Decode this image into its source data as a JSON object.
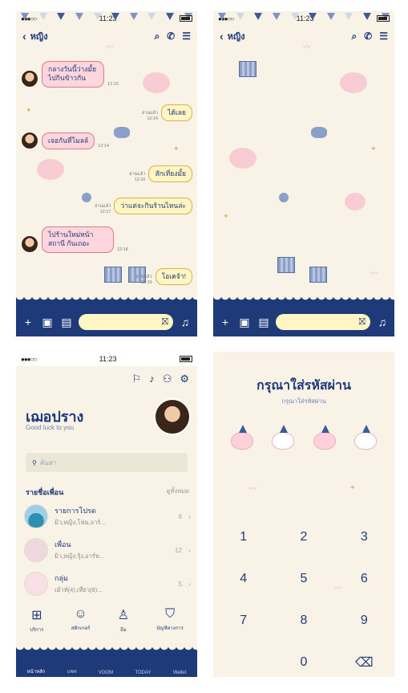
{
  "status": {
    "time": "11:23",
    "signal": "●●●○○"
  },
  "chat": {
    "title": "หญิง",
    "back_icon": "‹",
    "messages": [
      {
        "dir": "in",
        "text": "กลางวันนี้ว่างมั้ย ไปกินข้าวกัน",
        "time": "12:10",
        "read": ""
      },
      {
        "dir": "out",
        "text": "ได้เลย",
        "time": "12:14",
        "read": "อ่านแล้ว"
      },
      {
        "dir": "in",
        "text": "เจอกันที่โมลล์",
        "time": "12:14",
        "read": ""
      },
      {
        "dir": "out",
        "text": "สักเที่ยงมั้ย",
        "time": "12:16",
        "read": "อ่านแล้ว"
      },
      {
        "dir": "out",
        "text": "ว่าแต่จะกินร้านไหนล่ะ",
        "time": "12:17",
        "read": "อ่านแล้ว"
      },
      {
        "dir": "in",
        "text": "ไปร้านใหม่หน้าสถานี กันเถอะ",
        "time": "12:18",
        "read": ""
      },
      {
        "dir": "out",
        "text": "โอเคจ้า!",
        "time": "12:19",
        "read": "อ่านแล้ว"
      }
    ]
  },
  "profile": {
    "name": "เฌอปราง",
    "status_message": "Good luck to you",
    "search_placeholder": "ค้นหา",
    "friends_section": "รายชื่อเพื่อน",
    "see_all": "ดูทั้งหมด",
    "list": [
      {
        "name": "รายการโปรด",
        "sub": "มิว,หญิง,โฟม,อาร์...",
        "count": "6"
      },
      {
        "name": "เพื่อน",
        "sub": "มิว,หญิง,รุ้ง,อาร์ท...",
        "count": "12"
      },
      {
        "name": "กลุ่ม",
        "sub": "เม้าท์(4),เที่ยว(8)...",
        "count": "5"
      }
    ],
    "tabs": [
      {
        "icon": "⊞",
        "label": "บริการ"
      },
      {
        "icon": "☺",
        "label": "สติกเกอร์"
      },
      {
        "icon": "♙",
        "label": "ธีม"
      },
      {
        "icon": "⛉",
        "label": "บัญชีทางการ"
      }
    ],
    "bottom_nav": [
      "หน้าหลัก",
      "แชท",
      "VOOM",
      "TODAY",
      "Wallet"
    ]
  },
  "passcode": {
    "title": "กรุณาใส่รหัสผ่าน",
    "subtitle": "กรุณาใส่รหัสผ่าน",
    "keys": [
      [
        "1",
        "2",
        "3"
      ],
      [
        "4",
        "5",
        "6"
      ],
      [
        "7",
        "8",
        "9"
      ],
      [
        "",
        "0",
        "⌫"
      ]
    ]
  }
}
